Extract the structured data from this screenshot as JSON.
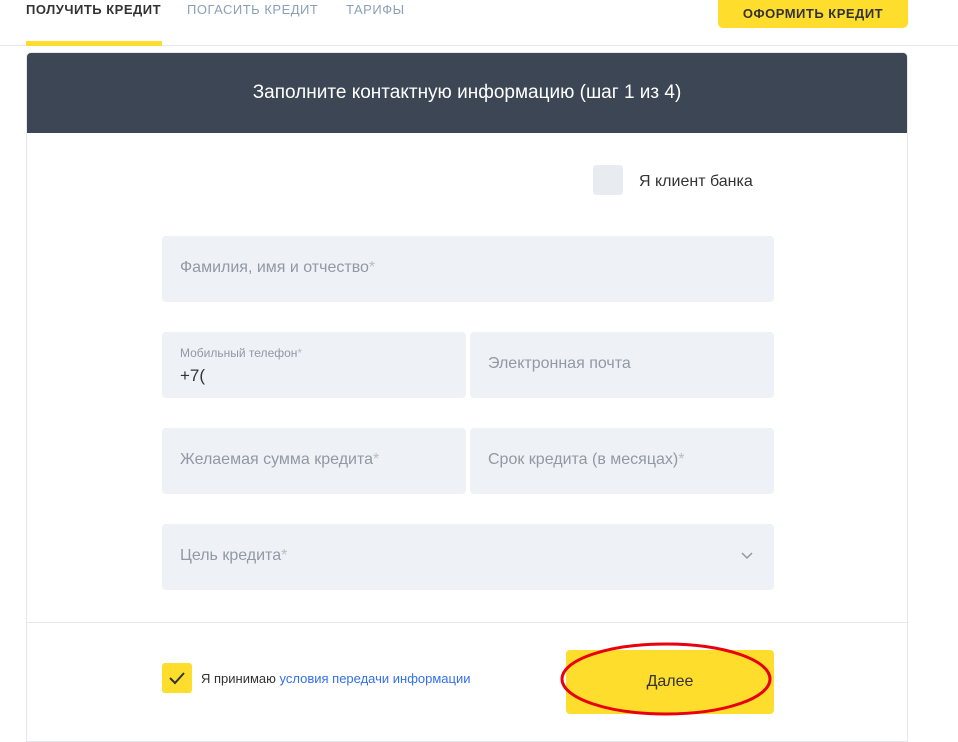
{
  "nav": {
    "tabs": [
      {
        "label": "ПОЛУЧИТЬ КРЕДИТ",
        "active": true
      },
      {
        "label": "ПОГАСИТЬ КРЕДИТ",
        "active": false
      },
      {
        "label": "ТАРИФЫ",
        "active": false
      }
    ],
    "cta_label": "ОФОРМИТЬ КРЕДИТ"
  },
  "form": {
    "header": "Заполните контактную информацию (шаг 1 из 4)",
    "client_checkbox_label": "Я клиент банка",
    "required_mark": "*",
    "fields": {
      "full_name": {
        "placeholder": "Фамилия, имя и отчество",
        "required": true
      },
      "phone": {
        "label": "Мобильный телефон",
        "value": "+7(",
        "required": true
      },
      "email": {
        "placeholder": "Электронная почта",
        "required": false
      },
      "amount": {
        "placeholder": "Желаемая сумма кредита",
        "required": true
      },
      "term": {
        "placeholder": "Срок кредита (в месяцах)",
        "required": true
      },
      "purpose": {
        "placeholder": "Цель кредита",
        "required": true,
        "icon": "chevron-down-icon"
      }
    },
    "agree_prefix": "Я принимаю",
    "agree_link": "условия передачи информации",
    "agree_checked": true,
    "next_label": "Далее"
  },
  "colors": {
    "accent": "#ffdd2d",
    "header_bg": "#3d4654",
    "field_bg": "#eef1f5",
    "link": "#336fee",
    "annotation": "#e8000b"
  }
}
